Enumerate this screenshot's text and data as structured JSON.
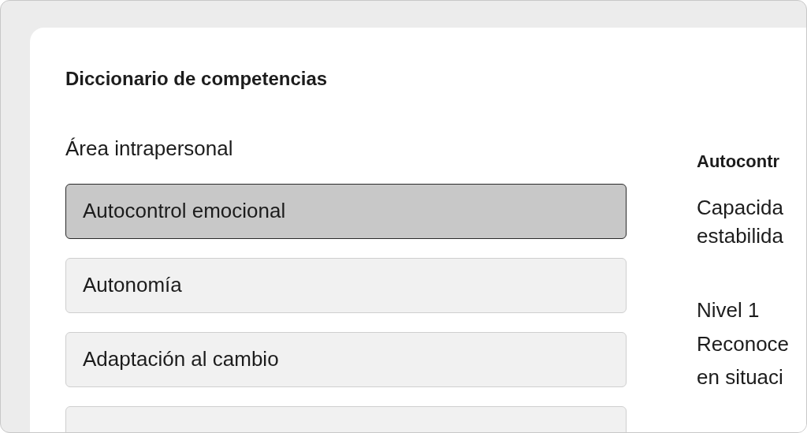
{
  "title": "Diccionario de competencias",
  "area": {
    "label": "Área intrapersonal",
    "items": [
      {
        "label": "Autocontrol emocional",
        "selected": true
      },
      {
        "label": "Autonomía",
        "selected": false
      },
      {
        "label": "Adaptación al cambio",
        "selected": false
      },
      {
        "selected": false
      }
    ]
  },
  "detail": {
    "heading": "Autocontr",
    "description_lines": [
      "Capacida",
      "estabilida"
    ],
    "level": {
      "title": "Nivel 1",
      "lines": [
        "Reconoce",
        "en situaci"
      ]
    }
  }
}
